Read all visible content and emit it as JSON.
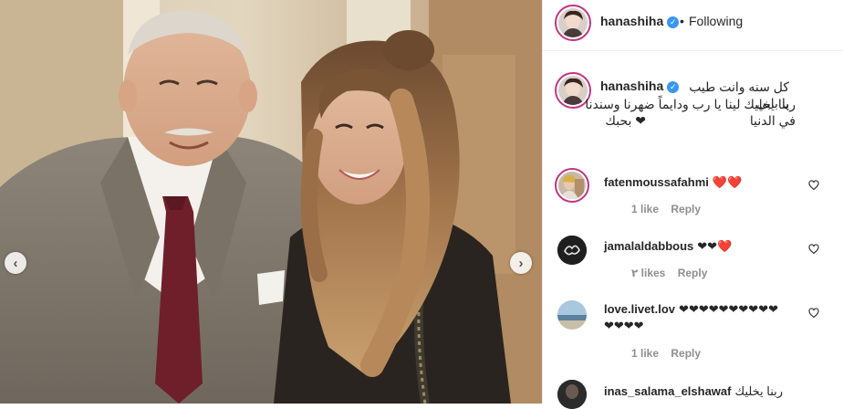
{
  "post": {
    "author": "hanashiha",
    "follow_status": "Following",
    "separator": "•",
    "caption": {
      "line1": "كل سنه وانت طيب يا بابي",
      "line2": "ربنا يخليك لينا يا رب ودايماً ضهرنا وسندنا في الدنيا",
      "line3": "❤ بحبك"
    }
  },
  "comments": [
    {
      "user": "fatenmoussafahmi",
      "text": "❤️❤️",
      "likes": "1 like",
      "reply": "Reply"
    },
    {
      "user": "jamalaldabbous",
      "text": "❤❤❤️",
      "likes": "٢ likes",
      "reply": "Reply"
    },
    {
      "user": "love.livet.lov",
      "text": "❤❤❤❤❤❤❤❤❤❤",
      "text2": "❤❤❤❤",
      "likes": "1 like",
      "reply": "Reply"
    },
    {
      "user": "inas_salama_elshawaf",
      "text": "ربنا يخليك"
    }
  ],
  "carousel": {
    "prev": "‹",
    "next": "›"
  },
  "icons": {
    "verified": "verified-badge-icon",
    "heart": "heart-outline-icon",
    "prev": "chevron-left-icon",
    "next": "chevron-right-icon"
  },
  "colors": {
    "text": "#262626",
    "muted": "#8e8e8e",
    "verified": "#3897f0",
    "story_ring": "#c13584",
    "border": "#efefef"
  }
}
